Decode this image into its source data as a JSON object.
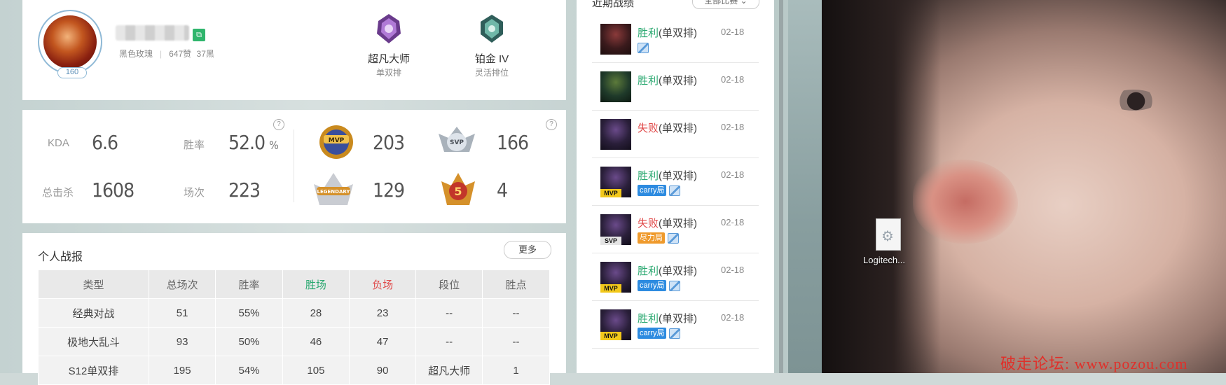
{
  "profile": {
    "level": "160",
    "server": "黑色玫瑰",
    "likes": "647赞",
    "dislikes": "37黑",
    "ranks": [
      {
        "name": "超凡大师",
        "queue": "单双排",
        "emblem": "master-emblem-icon"
      },
      {
        "name": "铂金 IV",
        "queue": "灵活排位",
        "emblem": "platinum-emblem-icon"
      }
    ]
  },
  "stats": {
    "kda_label": "KDA",
    "kda": "6.6",
    "winrate_label": "胜率",
    "winrate": "52.0",
    "winrate_unit": "%",
    "kills_label": "总击杀",
    "kills": "1608",
    "games_label": "场次",
    "games": "223",
    "help": "?",
    "badges": {
      "mvp": "203",
      "svp": "166",
      "legendary": "129",
      "pentakill": "4"
    }
  },
  "report": {
    "title": "个人战报",
    "more": "更多",
    "headers": [
      "类型",
      "总场次",
      "胜率",
      "胜场",
      "负场",
      "段位",
      "胜点"
    ],
    "rows": [
      [
        "经典对战",
        "51",
        "55%",
        "28",
        "23",
        "--",
        "--"
      ],
      [
        "极地大乱斗",
        "93",
        "50%",
        "46",
        "47",
        "--",
        "--"
      ],
      [
        "S12单双排",
        "195",
        "54%",
        "105",
        "90",
        "超凡大师",
        "1"
      ]
    ]
  },
  "recent": {
    "title": "近期战绩",
    "filter": "全部比赛",
    "matches": [
      {
        "result": "胜利",
        "win": true,
        "queue": "(单双排)",
        "date": "02-18",
        "tag": "",
        "badge": ""
      },
      {
        "result": "胜利",
        "win": true,
        "queue": "(单双排)",
        "date": "02-18",
        "tag": "",
        "badge": ""
      },
      {
        "result": "失败",
        "win": false,
        "queue": "(单双排)",
        "date": "02-18",
        "tag": "",
        "badge": ""
      },
      {
        "result": "胜利",
        "win": true,
        "queue": "(单双排)",
        "date": "02-18",
        "tag": "carry局",
        "badge": "MVP"
      },
      {
        "result": "失败",
        "win": false,
        "queue": "(单双排)",
        "date": "02-18",
        "tag": "尽力局",
        "badge": "SVP"
      },
      {
        "result": "胜利",
        "win": true,
        "queue": "(单双排)",
        "date": "02-18",
        "tag": "carry局",
        "badge": "MVP"
      },
      {
        "result": "胜利",
        "win": true,
        "queue": "(单双排)",
        "date": "02-18",
        "tag": "carry局",
        "badge": "MVP"
      }
    ]
  },
  "desktop": {
    "file_label": "Logitech...",
    "watermark": "破走论坛: www.pozou.com"
  },
  "colors": {
    "win": "#2aa870",
    "loss": "#e04848",
    "carry_tag": "#2d8be0",
    "fail_tag": "#ef9a2c",
    "watermark": "#e0302a"
  }
}
